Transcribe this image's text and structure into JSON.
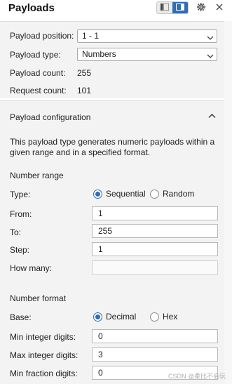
{
  "header": {
    "title": "Payloads",
    "icons": [
      "list-view-icon",
      "split-view-icon",
      "gear-icon",
      "close-icon"
    ],
    "accent": "#2f6db5"
  },
  "payload_sets": {
    "position_label": "Payload position:",
    "position_value": "1 - 1",
    "type_label": "Payload type:",
    "type_value": "Numbers",
    "count_label": "Payload count:",
    "count_value": "255",
    "request_label": "Request count:",
    "request_value": "101"
  },
  "config": {
    "title": "Payload configuration",
    "description": "This payload type generates numeric payloads within a given range and in a specified format.",
    "number_range": {
      "title": "Number range",
      "type_label": "Type:",
      "type_options": [
        "Sequential",
        "Random"
      ],
      "type_selected": "Sequential",
      "from_label": "From:",
      "from_value": "1",
      "to_label": "To:",
      "to_value": "255",
      "step_label": "Step:",
      "step_value": "1",
      "how_many_label": "How many:",
      "how_many_value": ""
    },
    "number_format": {
      "title": "Number format",
      "base_label": "Base:",
      "base_options": [
        "Decimal",
        "Hex"
      ],
      "base_selected": "Decimal",
      "min_int_label": "Min integer digits:",
      "min_int_value": "0",
      "max_int_label": "Max integer digits:",
      "max_int_value": "3",
      "min_frac_label": "Min fraction digits:",
      "min_frac_value": "0"
    }
  },
  "watermark": "CSDN @柔比不会玩"
}
